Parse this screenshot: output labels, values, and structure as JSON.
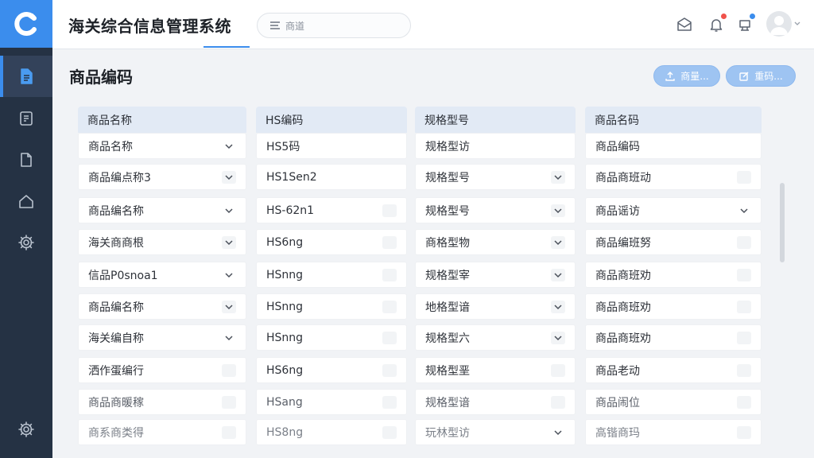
{
  "app": {
    "title": "海关综合信息管理系统"
  },
  "search": {
    "placeholder": "商道"
  },
  "page": {
    "title": "商品编码"
  },
  "actions": {
    "primary_label": "商量...",
    "secondary_label": "重码..."
  },
  "colors": {
    "accent": "#3b8ded",
    "rail": "#253244",
    "badge_red": "#f0524b",
    "badge_blue": "#3b8ded"
  },
  "columns": [
    {
      "header": "商品名称",
      "rows": [
        {
          "text": "商品名称",
          "control": "chevron"
        },
        {
          "text": "商品编点称3",
          "control": "chevron-box"
        },
        {
          "text": "商品编名称",
          "control": "chevron"
        },
        {
          "text": "海关商商根",
          "control": "chevron-box"
        },
        {
          "text": "信品Р0snoa1",
          "control": "chevron"
        },
        {
          "text": "商品编名称",
          "control": "chevron-box"
        },
        {
          "text": "海关编自称",
          "control": "chevron"
        },
        {
          "text": "洒作蛋编行",
          "control": "box"
        },
        {
          "text": "商品商暖稼",
          "control": "box"
        },
        {
          "text": "商系商类得",
          "control": "box"
        }
      ]
    },
    {
      "header": "HS编码",
      "rows": [
        {
          "text": "HS5码",
          "control": "none"
        },
        {
          "text": "HS1Sen2",
          "control": "none"
        },
        {
          "text": "HS-62n1",
          "control": "box"
        },
        {
          "text": "HS6ng",
          "control": "box"
        },
        {
          "text": "HSnng",
          "control": "box"
        },
        {
          "text": "HSnng",
          "control": "box"
        },
        {
          "text": "HSnng",
          "control": "box"
        },
        {
          "text": "HS6ng",
          "control": "box"
        },
        {
          "text": "HSang",
          "control": "box"
        },
        {
          "text": "HS8ng",
          "control": "box"
        }
      ]
    },
    {
      "header": "规格型号",
      "rows": [
        {
          "text": "规格型访",
          "control": "none"
        },
        {
          "text": "规格型号",
          "control": "chevron-box"
        },
        {
          "text": "规格型号",
          "control": "chevron-box"
        },
        {
          "text": "商格型物",
          "control": "chevron-box"
        },
        {
          "text": "规格型宰",
          "control": "chevron-box"
        },
        {
          "text": "地格型谙",
          "control": "chevron-box"
        },
        {
          "text": "规格型六",
          "control": "chevron-box"
        },
        {
          "text": "规格型垩",
          "control": "box"
        },
        {
          "text": "规格型谙",
          "control": "box"
        },
        {
          "text": "玩林型访",
          "control": "chevron"
        }
      ]
    },
    {
      "header": "商品名码",
      "rows": [
        {
          "text": "商品编码",
          "control": "none"
        },
        {
          "text": "商品商班动",
          "control": "box"
        },
        {
          "text": "商品谣访",
          "control": "chevron"
        },
        {
          "text": "商品编班努",
          "control": "box"
        },
        {
          "text": "商品商班劝",
          "control": "box"
        },
        {
          "text": "商品商班劝",
          "control": "box"
        },
        {
          "text": "商品商班劝",
          "control": "box"
        },
        {
          "text": "商品老动",
          "control": "box"
        },
        {
          "text": "商品闹位",
          "control": "box"
        },
        {
          "text": "高锴商玛",
          "control": "box"
        }
      ]
    }
  ]
}
